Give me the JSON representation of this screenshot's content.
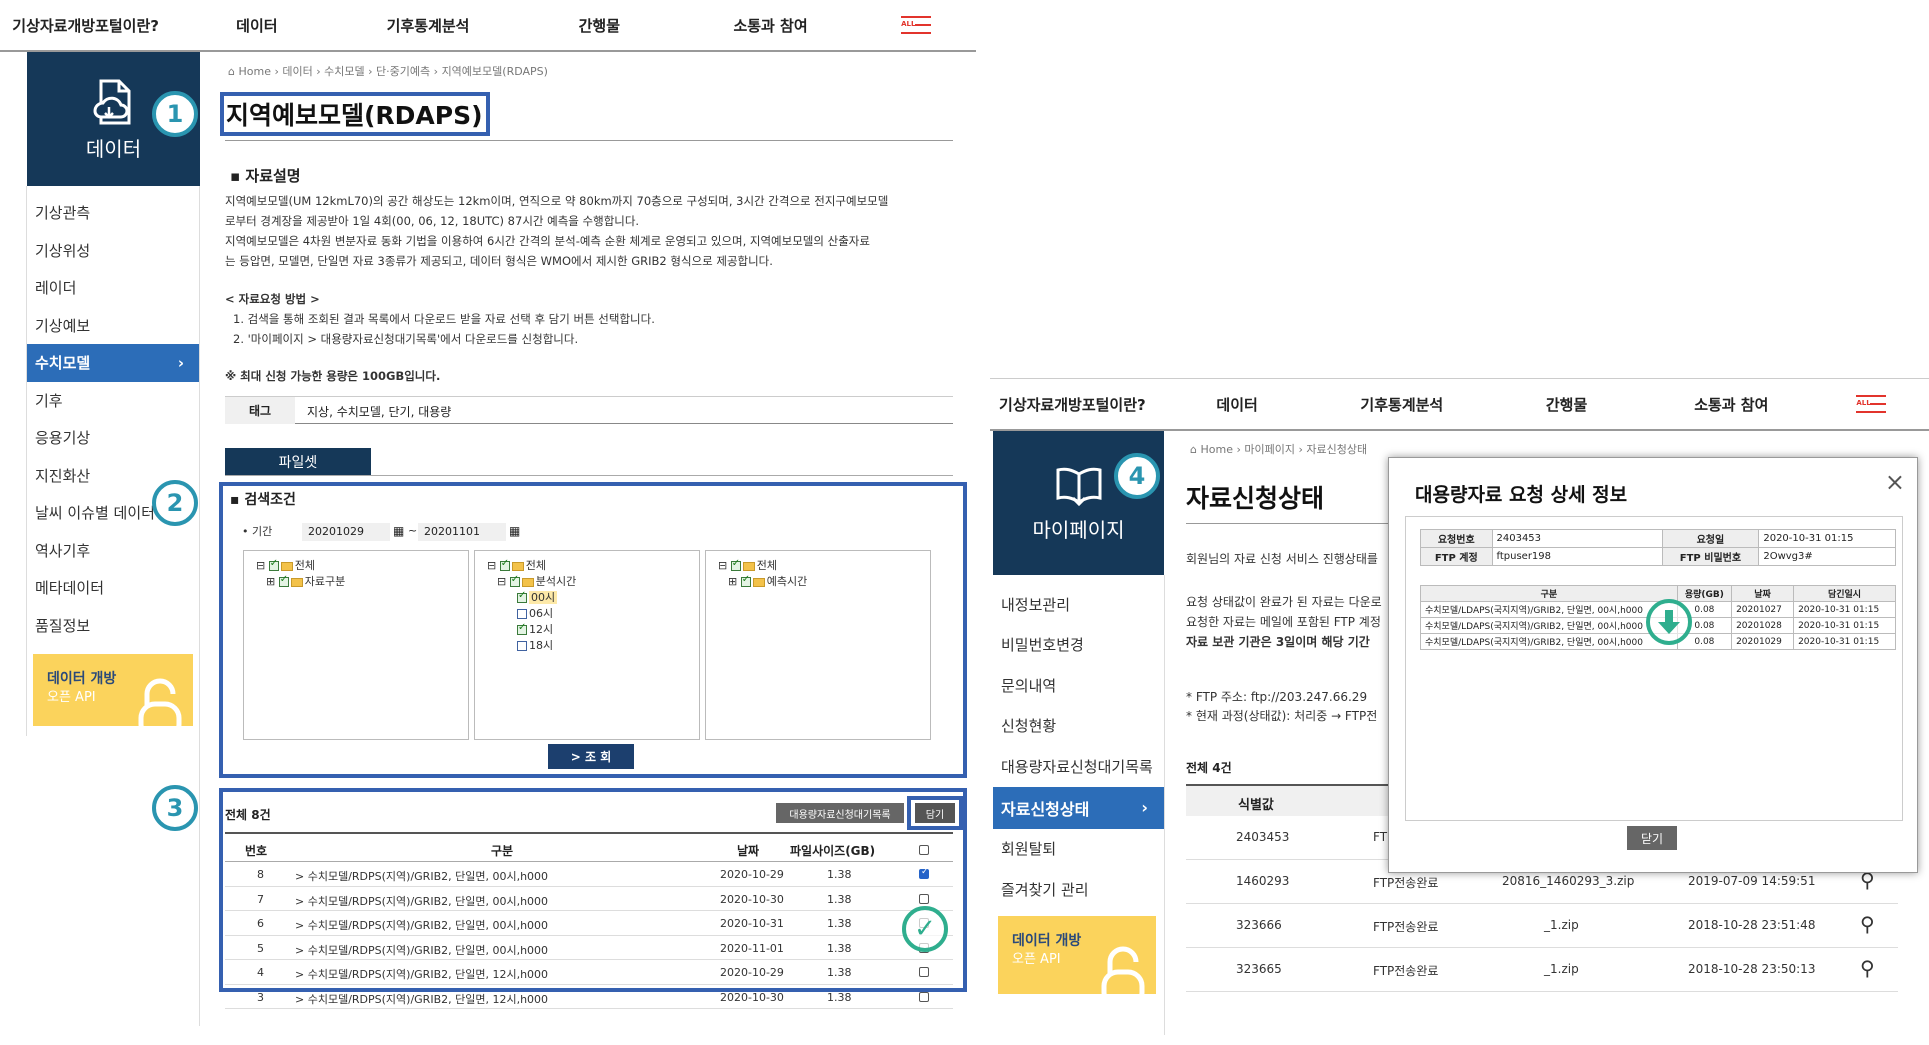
{
  "left": {
    "nav": [
      "기상자료개방포털이란?",
      "데이터",
      "기후통계분석",
      "간행물",
      "소통과 참여"
    ],
    "menu_all": "ALL",
    "section_title": "데이터",
    "menu": [
      "기상관측",
      "기상위성",
      "레이더",
      "기상예보",
      "수치모델",
      "기후",
      "응용기상",
      "지진화산",
      "날씨 이슈별 데이터",
      "역사기후",
      "메타데이터",
      "품질정보"
    ],
    "active_index": 4,
    "api_box": {
      "line1": "데이터 개방",
      "line2": "오픈 API"
    },
    "breadcrumb": [
      "Home",
      "데이터",
      "수치모델",
      "단·중기예측",
      "지역예보모델(RDAPS)"
    ],
    "title": "지역예보모델(RDAPS)",
    "desc_heading": "자료설명",
    "desc": [
      "지역예보모델(UM 12kmL70)의 공간 해상도는 12km이며, 연직으로 약 80km까지 70층으로 구성되며, 3시간 간격으로 전지구예보모델",
      "로부터 경계장을 제공받아 1일 4회(00, 06, 12, 18UTC) 87시간 예측을 수행합니다.",
      "지역예보모델은 4차원 변분자료 동화 기법을 이용하여 6시간 간격의 분석-예측 순환 체계로 운영되고 있으며, 지역예보모델의 산출자료",
      "는 등압면, 모델면, 단일면 자료 3종류가 제공되고, 데이터 형식은 WMO에서 제시한 GRIB2 형식으로 제공합니다."
    ],
    "method_heading": "< 자료요청 방법 >",
    "method": [
      "1. 검색을 통해 조회된 결과 목록에서 다운로드 받을 자료 선택 후 담기 버튼 선택합니다.",
      "2. '마이페이지 > 대용량자료신청대기목록'에서 다운로드를 신청합니다."
    ],
    "note": "※ 최대 신청 가능한 용량은 100GB입니다.",
    "tag_label": "태그",
    "tags": "지상, 수치모델, 단기, 대용량",
    "fileset_tab": "파일셋",
    "search_heading": "검색조건",
    "period_label": "• 기간",
    "date_from": "20201029",
    "date_to": "20201101",
    "tree1": {
      "root": "전체",
      "child": "자료구분"
    },
    "tree2": {
      "root": "전체",
      "child": "분석시간",
      "hours": [
        "00시",
        "06시",
        "12시",
        "18시"
      ],
      "checked": [
        true,
        false,
        true,
        false
      ]
    },
    "tree3": {
      "root": "전체",
      "child": "예측시간"
    },
    "search_button": "> 조 회",
    "total": "전체 8건",
    "waitlist_button": "대용량자료신청대기목록",
    "add_button": "담기",
    "columns": [
      "번호",
      "구분",
      "날짜",
      "파일사이즈(GB)"
    ],
    "rows": [
      {
        "no": "8",
        "name": "> 수치모델/RDPS(지역)/GRIB2, 단일면, 00시,h000",
        "date": "2020-10-29",
        "size": "1.38",
        "checked": true
      },
      {
        "no": "7",
        "name": "> 수치모델/RDPS(지역)/GRIB2, 단일면, 00시,h000",
        "date": "2020-10-30",
        "size": "1.38",
        "checked": false
      },
      {
        "no": "6",
        "name": "> 수치모델/RDPS(지역)/GRIB2, 단일면, 00시,h000",
        "date": "2020-10-31",
        "size": "1.38",
        "checked": false
      },
      {
        "no": "5",
        "name": "> 수치모델/RDPS(지역)/GRIB2, 단일면, 00시,h000",
        "date": "2020-11-01",
        "size": "1.38",
        "checked": false
      },
      {
        "no": "4",
        "name": "> 수치모델/RDPS(지역)/GRIB2, 단일면, 12시,h000",
        "date": "2020-10-29",
        "size": "1.38",
        "checked": false
      },
      {
        "no": "3",
        "name": "> 수치모델/RDPS(지역)/GRIB2, 단일면, 12시,h000",
        "date": "2020-10-30",
        "size": "1.38",
        "checked": false
      }
    ],
    "annotations": [
      "1",
      "2",
      "3"
    ]
  },
  "right": {
    "nav": [
      "기상자료개방포털이란?",
      "데이터",
      "기후통계분석",
      "간행물",
      "소통과 참여"
    ],
    "menu_all": "ALL",
    "section_title": "마이페이지",
    "menu": [
      "내정보관리",
      "비밀번호변경",
      "문의내역",
      "신청현황",
      "대용량자료신청대기목록",
      "자료신청상태",
      "회원탈퇴",
      "즐겨찾기 관리"
    ],
    "active_index": 5,
    "api_box": {
      "line1": "데이터 개방",
      "line2": "오픈 API"
    },
    "breadcrumb": [
      "Home",
      "마이페이지",
      "자료신청상태"
    ],
    "title": "자료신청상태",
    "text1": "회원님의 자료 신청 서비스 진행상태를",
    "text2": "요청 상태값이 완료가 된 자료는 다운로",
    "text3": "요청한 자료는 메일에 포함된 FTP 계정",
    "text4": "자료 보관 기관은 3일이며 해당 기간",
    "ftp": "* FTP 주소: ftp://203.247.66.29",
    "process": "* 현재 과정(상태값): 처리중 → FTP전",
    "total": "전체 4건",
    "col_id": "식별값",
    "rows": [
      {
        "id": "2403453",
        "status": "FTP",
        "file": "",
        "date": ""
      },
      {
        "id": "1460293",
        "status": "FTP전송완료",
        "file": "20816_1460293_3.zip",
        "date": "2019-07-09 14:59:51"
      },
      {
        "id": "323666",
        "status": "FTP전송완료",
        "file": "_1.zip",
        "date": "2018-10-28 23:51:48"
      },
      {
        "id": "323665",
        "status": "FTP전송완료",
        "file": "_1.zip",
        "date": "2018-10-28 23:50:13"
      }
    ],
    "annotation": "4",
    "modal": {
      "title": "대용량자료 요청 상세 정보",
      "req_no_label": "요청번호",
      "req_no": "2403453",
      "req_date_label": "요청일",
      "req_date": "2020-10-31 01:15",
      "ftp_label": "FTP 계정",
      "ftp_account": "ftpuser198",
      "pw_label": "FTP 비밀번호",
      "pw": "2Owvg3#",
      "cols": [
        "구분",
        "용량(GB)",
        "날짜",
        "담긴일시"
      ],
      "rows": [
        [
          "수치모델/LDAPS(국지지역)/GRIB2, 단일면, 00시,h000",
          "0.08",
          "20201027",
          "2020-10-31 01:15"
        ],
        [
          "수치모델/LDAPS(국지지역)/GRIB2, 단일면, 00시,h000",
          "0.08",
          "20201028",
          "2020-10-31 01:15"
        ],
        [
          "수치모델/LDAPS(국지지역)/GRIB2, 단일면, 00시,h000",
          "0.08",
          "20201029",
          "2020-10-31 01:15"
        ]
      ],
      "close_button": "닫기"
    }
  }
}
